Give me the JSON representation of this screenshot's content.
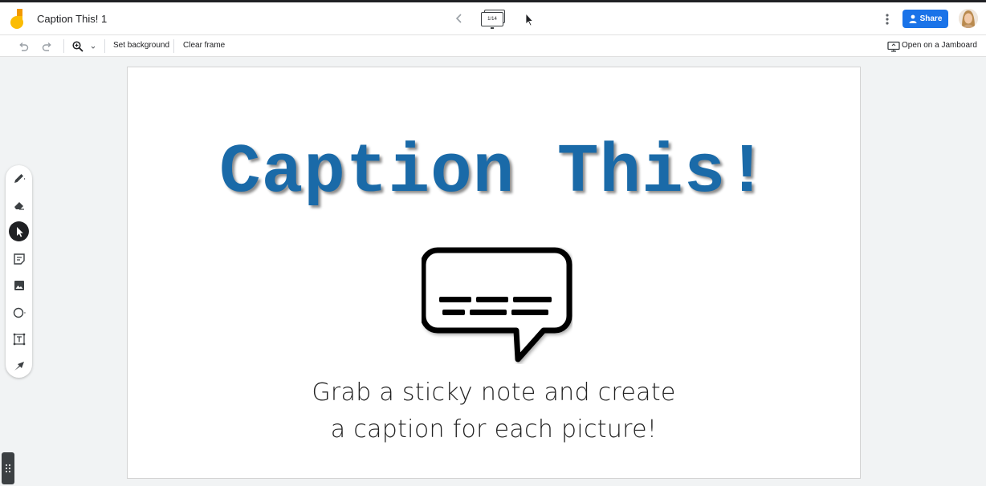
{
  "header": {
    "title": "Caption This! 1",
    "frame_counter": "1/14",
    "share_label": "Share"
  },
  "toolbar": {
    "set_background_label": "Set background",
    "clear_frame_label": "Clear frame",
    "open_on_jamboard_label": "Open on a Jamboard"
  },
  "frame": {
    "heading": "Caption This!",
    "subtitle_line1": "Grab a sticky note and create",
    "subtitle_line2": "a caption for each picture!"
  },
  "side_tools": [
    "pen-icon",
    "eraser-icon",
    "select-icon",
    "sticky-note-icon",
    "image-icon",
    "circle-icon",
    "text-box-icon",
    "laser-icon"
  ],
  "active_tool": "select-icon",
  "colors": {
    "accent": "#1a73e8",
    "heading": "#1a6aa8",
    "logo_orange": "#f29900",
    "logo_yellow": "#fbbc04"
  }
}
